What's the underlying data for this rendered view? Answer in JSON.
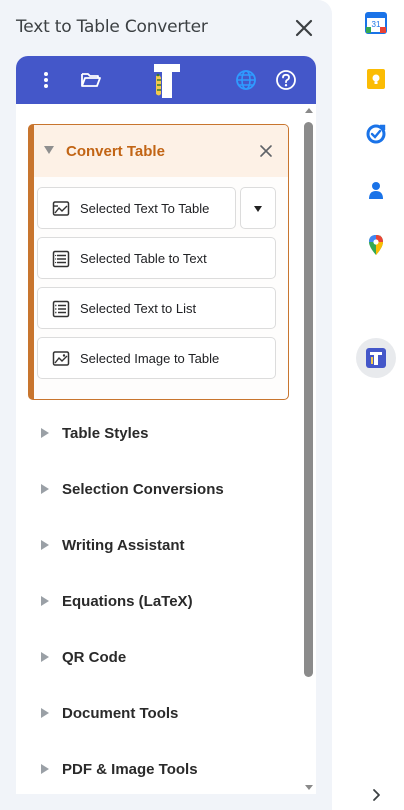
{
  "panel": {
    "title": "Text to Table Converter"
  },
  "toolbar": {
    "logo_letter": "T"
  },
  "convert_table": {
    "title": "Convert Table",
    "actions": [
      {
        "label": "Selected Text To Table",
        "icon": "text-to-table-icon"
      },
      {
        "label": "Selected Table to Text",
        "icon": "table-to-text-icon"
      },
      {
        "label": "Selected Text to List",
        "icon": "text-to-list-icon"
      },
      {
        "label": "Selected Image to Table",
        "icon": "image-to-table-icon"
      }
    ]
  },
  "sections": [
    {
      "label": "Table Styles"
    },
    {
      "label": "Selection Conversions"
    },
    {
      "label": "Writing Assistant"
    },
    {
      "label": "Equations (LaTeX)"
    },
    {
      "label": "QR Code"
    },
    {
      "label": "Document Tools"
    },
    {
      "label": "PDF & Image Tools"
    }
  ],
  "side_rail": {
    "calendar_day": "31",
    "apps": [
      "calendar-icon",
      "keep-icon",
      "tasks-icon",
      "contacts-icon",
      "maps-icon",
      "text-to-table-addon-icon"
    ]
  },
  "colors": {
    "toolbar": "#4457c9",
    "accent": "#c8752e",
    "accent_text": "#c26515"
  }
}
